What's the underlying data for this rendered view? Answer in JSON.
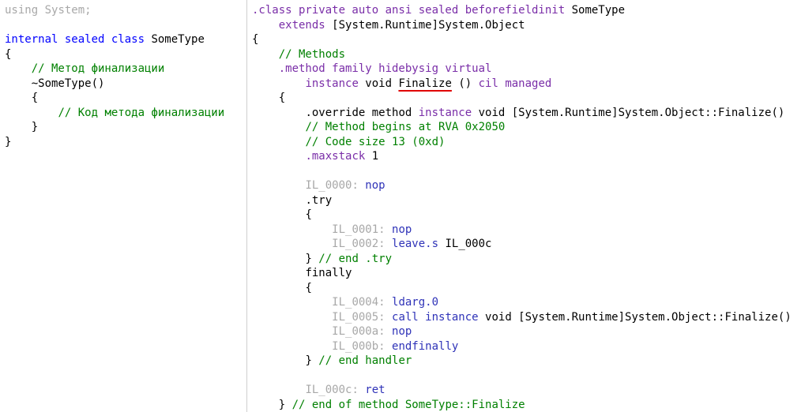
{
  "csharp": {
    "using_kw": "using",
    "using_ns": " System;",
    "class_kw": "internal sealed class",
    "class_name": " SomeType",
    "brace_open": "{",
    "comment1": "// Метод финализации",
    "destructor": "~SomeType()",
    "inner_open": "{",
    "comment2": "// Код метода финализации",
    "inner_close": "}",
    "brace_close": "}"
  },
  "il": {
    "class_kw": ".class private auto ansi sealed beforefieldinit",
    "class_name": " SomeType",
    "extends_kw": "extends",
    "extends_type": " [System.Runtime]System.Object",
    "open1": "{",
    "methods_comment": "// Methods",
    "method_kw": ".method family hidebysig virtual",
    "instance_kw": "instance",
    "void_kw": " void ",
    "finalize": "Finalize",
    "parens": " () ",
    "cil_kw": "cil managed",
    "open2": "{",
    "override_kw": ".override method",
    "override_instance": " instance",
    "override_rest": " void [System.Runtime]System.Object::Finalize()",
    "rva_comment": "// Method begins at RVA 0x2050",
    "size_comment": "// Code size 13 (0xd)",
    "maxstack_kw": ".maxstack",
    "maxstack_val": " 1",
    "l0000": "IL_0000:",
    "op0000": " nop",
    "try_kw": ".try",
    "open3": "{",
    "l0001": "IL_0001:",
    "op0001": " nop",
    "l0002": "IL_0002:",
    "op0002": " leave.s",
    "arg0002": " IL_000c",
    "close_try": "} ",
    "end_try": "// end .try",
    "finally_kw": "finally",
    "open4": "{",
    "l0004": "IL_0004:",
    "op0004": " ldarg.0",
    "l0005": "IL_0005:",
    "op0005": " call instance",
    "arg0005": " void [System.Runtime]System.Object::Finalize()",
    "l000a": "IL_000a:",
    "op000a": " nop",
    "l000b": "IL_000b:",
    "op000b": " endfinally",
    "close_handler": "} ",
    "end_handler": "// end handler",
    "l000c": "IL_000c:",
    "op000c": " ret",
    "close_method": "} ",
    "end_method": "// end of method SomeType::Finalize"
  }
}
